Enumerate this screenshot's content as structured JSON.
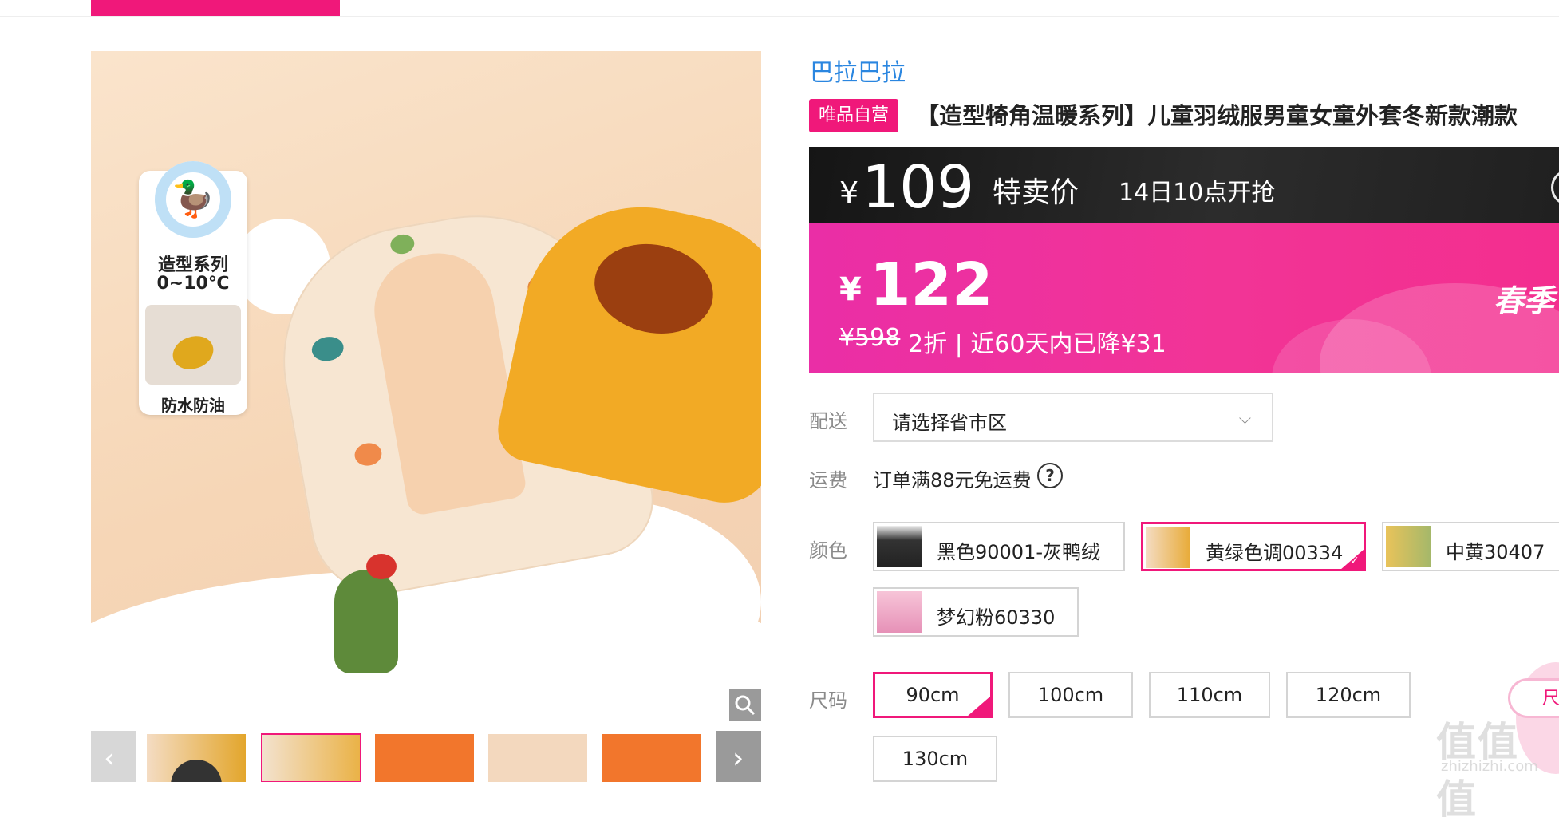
{
  "brand": "巴拉巴拉",
  "product": {
    "self_tag": "唯品自营",
    "title": "【造型犄角温暖系列】儿童羽绒服男童女童外套冬新款潮款"
  },
  "gallery": {
    "badge_line1": "造型系列",
    "badge_line2": "0~10℃",
    "badge_line3": "防水防油",
    "icons": {
      "zoom": "magnifier-icon",
      "play": "play-icon",
      "prev": "chevron-left-icon",
      "next": "chevron-right-icon"
    }
  },
  "flash_sale": {
    "currency": "¥",
    "price": "109",
    "label": "特卖价",
    "time": "14日10点开抢"
  },
  "current_price": {
    "currency": "¥",
    "price": "122",
    "original": "¥598",
    "detail": "2折 | 近60天内已降¥31",
    "promo": "春季"
  },
  "delivery": {
    "label": "配送",
    "placeholder": "请选择省市区"
  },
  "shipping": {
    "label": "运费",
    "text": "订单满88元免运费"
  },
  "color": {
    "label": "颜色",
    "options": [
      {
        "name": "黑色90001-灰鸭绒",
        "selected": false
      },
      {
        "name": "黄绿色调00334",
        "selected": true
      },
      {
        "name": "中黄30407",
        "selected": false
      },
      {
        "name": "梦幻粉60330",
        "selected": false
      }
    ]
  },
  "size": {
    "label": "尺码",
    "options": [
      "90cm",
      "100cm",
      "110cm",
      "120cm",
      "130cm"
    ],
    "selected": "90cm",
    "guide_label": "尺"
  },
  "watermark": {
    "main": "值值值",
    "sub": "zhizhizhi.com"
  },
  "colors": {
    "accent": "#f0187a",
    "brand_link": "#2a86e0",
    "flash_bg": "#1e1e1e"
  }
}
